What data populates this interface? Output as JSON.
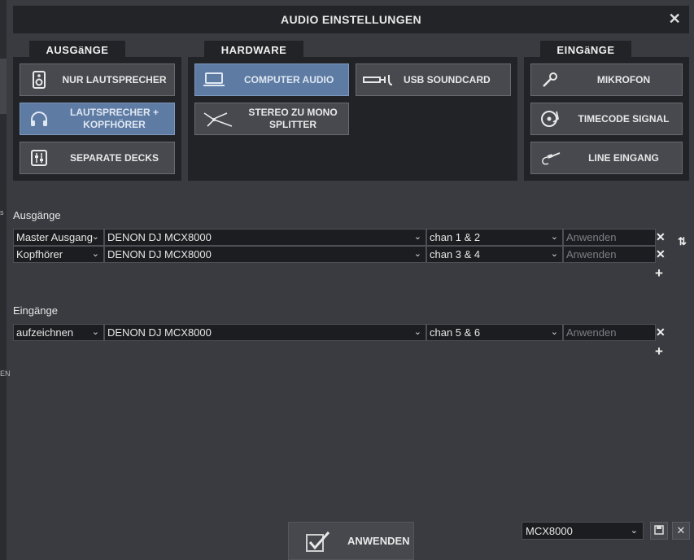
{
  "dialog": {
    "title": "AUDIO EINSTELLUNGEN",
    "close_symbol": "✕"
  },
  "outputs_panel": {
    "tab": "AUSGäNGE",
    "options": [
      {
        "label": "NUR LAUTSPRECHER",
        "icon": "speaker-icon",
        "active": false
      },
      {
        "label": "LAUTSPRECHER + KOPFHÖRER",
        "icon": "headphones-icon",
        "active": true
      },
      {
        "label": "SEPARATE DECKS",
        "icon": "mixer-icon",
        "active": false
      }
    ]
  },
  "hardware_panel": {
    "tab": "HARDWARE",
    "options": [
      {
        "label": "COMPUTER AUDIO",
        "icon": "laptop-icon",
        "active": true
      },
      {
        "label": "USB SOUNDCARD",
        "icon": "usb-soundcard-icon",
        "active": false
      },
      {
        "label": "STEREO ZU MONO SPLITTER",
        "icon": "splitter-cable-icon",
        "active": false
      }
    ]
  },
  "inputs_panel": {
    "tab": "EINGäNGE",
    "options": [
      {
        "label": "MIKROFON",
        "icon": "microphone-icon",
        "active": false
      },
      {
        "label": "TIMECODE SIGNAL",
        "icon": "turntable-icon",
        "active": false
      },
      {
        "label": "LINE EINGANG",
        "icon": "line-cable-icon",
        "active": false
      }
    ]
  },
  "outputs_section": {
    "label": "Ausgänge",
    "rows": [
      {
        "type": "Master Ausgang",
        "device": "DENON DJ MCX8000",
        "channels": "chan 1 & 2",
        "apply_placeholder": "Anwenden"
      },
      {
        "type": "Kopfhörer",
        "device": "DENON DJ MCX8000",
        "channels": "chan 3 & 4",
        "apply_placeholder": "Anwenden"
      }
    ],
    "add_symbol": "+",
    "remove_symbol": "✕"
  },
  "inputs_section": {
    "label": "Eingänge",
    "rows": [
      {
        "type": "aufzeichnen",
        "device": "DENON DJ MCX8000",
        "channels": "chan 5 & 6",
        "apply_placeholder": "Anwenden"
      }
    ],
    "add_symbol": "+",
    "remove_symbol": "✕"
  },
  "footer": {
    "apply_label": "ANWENDEN",
    "preset_value": "MCX8000"
  },
  "left_edge": {
    "glyph_top": "s",
    "glyph_bottom": "EN"
  },
  "colors": {
    "active": "#5d7ba3",
    "panel": "#222327",
    "background": "#3a3b40"
  }
}
